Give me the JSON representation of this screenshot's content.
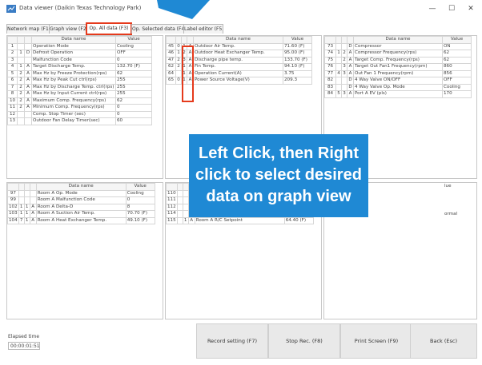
{
  "window": {
    "title": "Data viewer (Daikin Texas Technology Park)",
    "minimize_glyph": "—",
    "maximize_glyph": "☐",
    "close_glyph": "✕"
  },
  "tabs": [
    {
      "label": "Network map (F1)"
    },
    {
      "label": "Graph view (F2)"
    },
    {
      "label": "Op. All data (F3)"
    },
    {
      "label": "Op. Selected data (F4)"
    },
    {
      "label": "Label editor (F5)"
    }
  ],
  "columns": {
    "name": "Data name",
    "value": "Value"
  },
  "panels": {
    "top_left": [
      [
        "1",
        "",
        "",
        "Operation Mode",
        "Cooling"
      ],
      [
        "2",
        "1",
        "D",
        "Defrost Operation",
        "OFF"
      ],
      [
        "3",
        "",
        "",
        "Malfunction Code",
        "0"
      ],
      [
        "4",
        "1",
        "A",
        "Target Discharge Temp.",
        "132.70 (F)"
      ],
      [
        "5",
        "2",
        "A",
        "Max Hz by Freeze Protection(rps)",
        "62"
      ],
      [
        "6",
        "2",
        "A",
        "Max Hz by Peak Cut ctrl(rps)",
        "255"
      ],
      [
        "7",
        "2",
        "A",
        "Max Hz by Discharge Temp. ctrl(rps)",
        "255"
      ],
      [
        "8",
        "2",
        "A",
        "Max Hz by Input Current ctrl(rps)",
        "255"
      ],
      [
        "10",
        "2",
        "A",
        "Maximum Comp. Frequency(rps)",
        "62"
      ],
      [
        "11",
        "2",
        "A",
        "Minimum Comp. Frequency(rps)",
        "0"
      ],
      [
        "12",
        "",
        "",
        "Comp. Stop Timer (sec)",
        "0"
      ],
      [
        "13",
        "",
        "",
        "Outdoor Fan Delay Timer(sec)",
        "60"
      ]
    ],
    "top_middle": [
      [
        "45",
        "0",
        "1",
        "A",
        "Outdoor Air Temp.",
        "71.60 (F)"
      ],
      [
        "46",
        "1",
        "2",
        "A",
        "Outdoor Heat Exchanger Temp.",
        "95.00 (F)"
      ],
      [
        "47",
        "2",
        "3",
        "A",
        "Discharge pipe temp.",
        "133.70 (F)"
      ],
      [
        "62",
        "2",
        "1",
        "A",
        "Fin Temp.",
        "94.10 (F)"
      ],
      [
        "64",
        "",
        "1",
        "A",
        "Operation Current(A)",
        "3.75"
      ],
      [
        "65",
        "0",
        "1",
        "A",
        "Power Source Voltage(V)",
        "209.3"
      ]
    ],
    "top_right": [
      [
        "73",
        "",
        "",
        "D",
        "Compressor",
        "ON"
      ],
      [
        "74",
        "1",
        "2",
        "A",
        "Compressor Frequency(rps)",
        "62"
      ],
      [
        "75",
        "",
        "2",
        "A",
        "Target Comp. Frequency(rps)",
        "62"
      ],
      [
        "76",
        "",
        "3",
        "A",
        "Target Out Fan1 Frequency(rpm)",
        "860"
      ],
      [
        "77",
        "4",
        "3",
        "A",
        "Out Fan 1 Frequency(rpm)",
        "856"
      ],
      [
        "82",
        "",
        "",
        "D",
        "4 Way Valve ON/OFF",
        "OFF"
      ],
      [
        "83",
        "",
        "",
        "D",
        "4 Way Valve Op. Mode",
        "Cooling"
      ],
      [
        "84",
        "5",
        "3",
        "A",
        "Port A EV (pls)",
        "170"
      ]
    ],
    "bottom_left": [
      [
        "97",
        "",
        "",
        "",
        "Room A Op. Mode",
        "Cooling"
      ],
      [
        "99",
        "",
        "",
        "",
        "Room A Malfunction Code",
        "0"
      ],
      [
        "102",
        "1",
        "1",
        "A",
        "Room A Delta-D",
        "8"
      ],
      [
        "103",
        "1",
        "1",
        "A",
        "Room A Suction Air Temp.",
        "70.70 (F)"
      ],
      [
        "104",
        "7",
        "1",
        "A",
        "Room A Heat Exchanger Temp.",
        "49.10 (F)"
      ]
    ],
    "bottom_middle": [
      [
        "110",
        "",
        "",
        "",
        "",
        ""
      ],
      [
        "111",
        "",
        "",
        "",
        "",
        ""
      ],
      [
        "112",
        "",
        "",
        "",
        "",
        ""
      ],
      [
        "114",
        "",
        "",
        "",
        "",
        ""
      ],
      [
        "115",
        "",
        "1",
        "A",
        "Room A R/C Setpoint",
        "64.40 (F)"
      ]
    ],
    "bottom_right_header_partial": "lue",
    "bottom_right_partial_value": "ormal"
  },
  "footer": {
    "elapsed_label": "Elapsed time",
    "elapsed_value": "00:00:01:51",
    "record_setting": "Record setting (F7)",
    "stop_rec": "Stop Rec. (F8)",
    "print_screen": "Print Screen (F9)",
    "back": "Back (Esc)"
  },
  "callout": {
    "line1": "Left Click, then Right",
    "line2": "click to select desired",
    "line3": "data on graph view"
  },
  "colors": {
    "accent_red": "#e53a1c",
    "callout_blue": "#1f89d4"
  }
}
